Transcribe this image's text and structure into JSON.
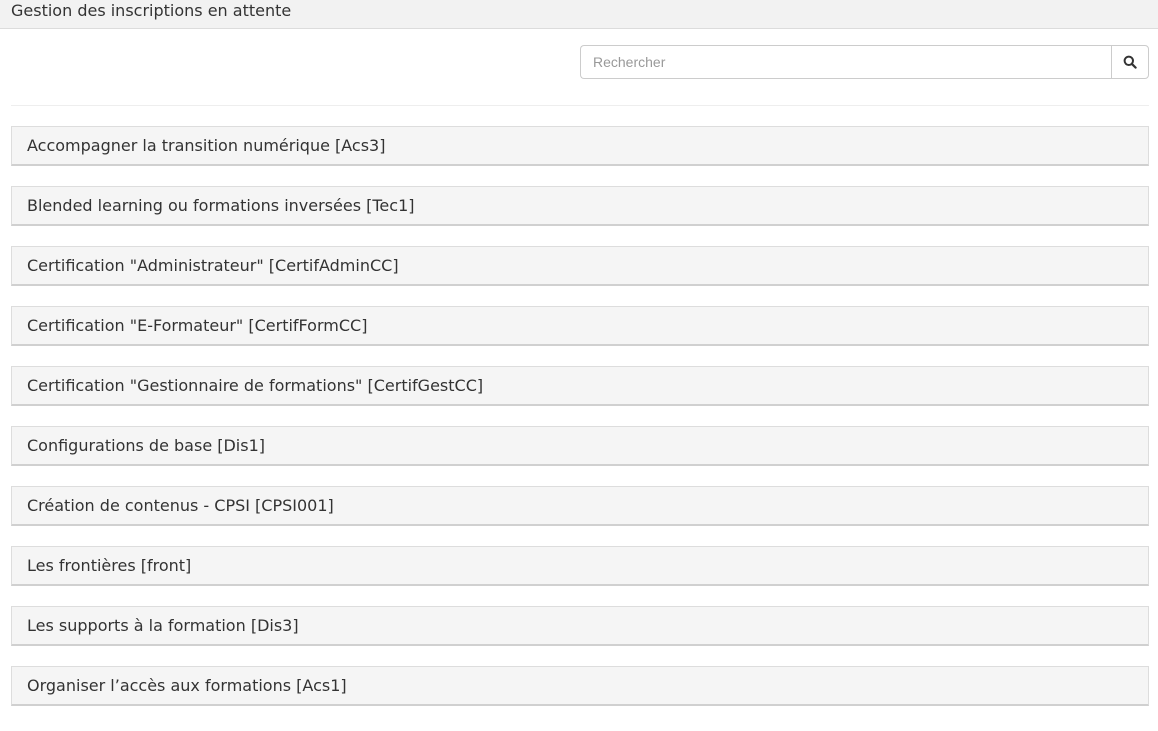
{
  "header": {
    "title": "Gestion des inscriptions en attente"
  },
  "search": {
    "placeholder": "Rechercher",
    "value": "",
    "button_icon": "search-icon"
  },
  "courses": [
    {
      "label": "Accompagner la transition numérique [Acs3]"
    },
    {
      "label": "Blended learning ou formations inversées [Tec1]"
    },
    {
      "label": "Certification \"Administrateur\" [CertifAdminCC]"
    },
    {
      "label": "Certification \"E-Formateur\" [CertifFormCC]"
    },
    {
      "label": "Certification \"Gestionnaire de formations\" [CertifGestCC]"
    },
    {
      "label": "Configurations de base [Dis1]"
    },
    {
      "label": "Création de contenus - CPSI [CPSI001]"
    },
    {
      "label": "Les frontières [front]"
    },
    {
      "label": "Les supports à la formation [Dis3]"
    },
    {
      "label": "Organiser l’accès aux formations [Acs1]"
    }
  ]
}
